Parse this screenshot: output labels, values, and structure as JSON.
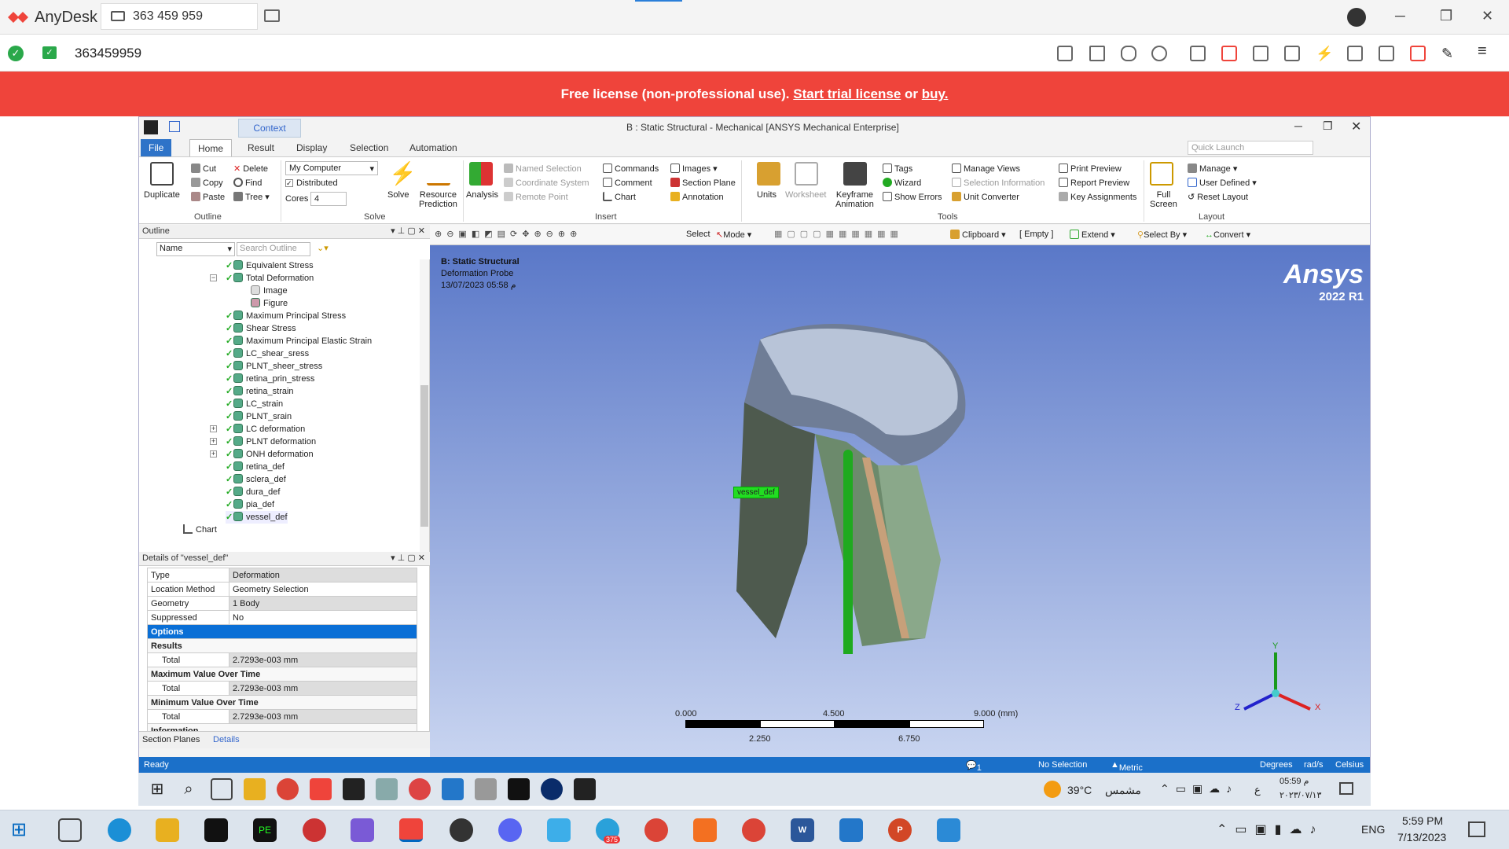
{
  "anydesk": {
    "app_name": "AnyDesk",
    "session_id": "363 459 959",
    "address": "363459959",
    "banner": {
      "text": "Free license (non-professional use).",
      "link1": "Start trial license",
      "or": "or",
      "link2": "buy."
    }
  },
  "ansys": {
    "window_title": "B : Static Structural - Mechanical [ANSYS Mechanical Enterprise]",
    "context_tab": "Context",
    "tabs": [
      "File",
      "Home",
      "Result",
      "Display",
      "Selection",
      "Automation"
    ],
    "quick_launch_placeholder": "Quick Launch",
    "ribbon": {
      "duplicate": "Duplicate",
      "cut": "Cut",
      "copy": "Copy",
      "paste": "Paste",
      "delete": "Delete",
      "find": "Find",
      "tree": "Tree",
      "outline_group": "Outline",
      "my_computer": "My Computer",
      "distributed": "Distributed",
      "cores_label": "Cores",
      "cores_value": "4",
      "solve": "Solve",
      "resource_prediction_1": "Resource",
      "resource_prediction_2": "Prediction",
      "solve_group": "Solve",
      "analysis": "Analysis",
      "named_selection": "Named Selection",
      "coordinate_system": "Coordinate System",
      "remote_point": "Remote Point",
      "commands": "Commands",
      "comment": "Comment",
      "chart": "Chart",
      "images": "Images",
      "section_plane": "Section Plane",
      "annotation": "Annotation",
      "insert_group": "Insert",
      "units": "Units",
      "worksheet": "Worksheet",
      "keyframe_1": "Keyframe",
      "keyframe_2": "Animation",
      "tags": "Tags",
      "wizard": "Wizard",
      "show_errors": "Show Errors",
      "manage_views": "Manage Views",
      "selection_information": "Selection Information",
      "unit_converter": "Unit Converter",
      "print_preview": "Print Preview",
      "report_preview": "Report Preview",
      "key_assignments": "Key Assignments",
      "tools_group": "Tools",
      "full_1": "Full",
      "full_2": "Screen",
      "manage": "Manage",
      "user_defined": "User Defined",
      "reset_layout": "Reset Layout",
      "layout_group": "Layout"
    },
    "outline": {
      "title": "Outline",
      "name_filter": "Name",
      "search_placeholder": "Search Outline",
      "items": [
        "Equivalent Stress",
        "Total Deformation",
        "Image",
        "Figure",
        "Maximum Principal Stress",
        "Shear Stress",
        "Maximum Principal Elastic Strain",
        "LC_shear_sress",
        "PLNT_sheer_stress",
        "retina_prin_stress",
        "retina_strain",
        "LC_strain",
        "PLNT_srain",
        "LC deformation",
        "PLNT deformation",
        "ONH deformation",
        "retina_def",
        "sclera_def",
        "dura_def",
        "pia_def",
        "vessel_def",
        "Chart"
      ]
    },
    "details": {
      "title": "Details of \"vessel_def\"",
      "rows": [
        {
          "k": "Type",
          "v": "Deformation"
        },
        {
          "k": "Location Method",
          "v": "Geometry Selection"
        },
        {
          "k": "Geometry",
          "v": "1 Body"
        },
        {
          "k": "Suppressed",
          "v": "No"
        }
      ],
      "options": "Options",
      "results": "Results",
      "total_label": "Total",
      "total_value": "2.7293e-003 mm",
      "max_over_time": "Maximum Value Over Time",
      "min_over_time": "Minimum Value Over Time",
      "information": "Information",
      "tab_section_planes": "Section Planes",
      "tab_details": "Details"
    },
    "viewport_toolbar": {
      "select": "Select",
      "mode": "Mode",
      "clipboard": "Clipboard",
      "empty": "[ Empty ]",
      "extend": "Extend",
      "select_by": "Select By",
      "convert": "Convert"
    },
    "viewport": {
      "system": "B: Static Structural",
      "object": "Deformation Probe",
      "date": "13/07/2023 05:58 م",
      "brand": "Ansys",
      "version": "2022 R1",
      "probe_label": "vessel_def",
      "scale_top": [
        "0.000",
        "4.500",
        "9.000 (mm)"
      ],
      "scale_bottom": [
        "2.250",
        "6.750"
      ],
      "axis_x": "X",
      "axis_y": "Y",
      "axis_z": "Z"
    },
    "status": {
      "ready": "Ready",
      "messages": "1 Message",
      "selection": "No Selection",
      "units": "Metric (mm, kg, N, s, mV, mA)",
      "degrees": "Degrees",
      "rads": "rad/s",
      "celsius": "Celsius"
    }
  },
  "remote_taskbar": {
    "weather_temp": "39°C",
    "weather_desc": "مشمس",
    "lang": "ع",
    "time": "05:59 م",
    "date": "٢٠٢٣/٠٧/١٣"
  },
  "local_taskbar": {
    "telegram_badge": "375",
    "lang": "ENG",
    "time": "5:59 PM",
    "date": "7/13/2023"
  }
}
